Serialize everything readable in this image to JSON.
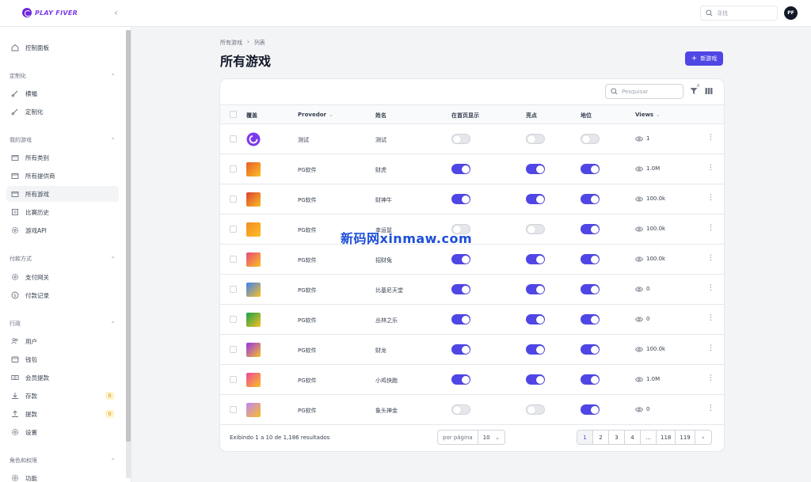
{
  "app": {
    "logo_text": "PLAY FIVER",
    "search_placeholder": "寻找",
    "avatar_initials": "PF"
  },
  "sidebar": {
    "dashboard": "控制面板",
    "groups": [
      {
        "title": "定制化",
        "items": [
          {
            "label": "横幅",
            "icon": "brush-icon"
          },
          {
            "label": "定制化",
            "icon": "brush-icon"
          }
        ]
      },
      {
        "title": "我的游戏",
        "items": [
          {
            "label": "所有类别",
            "icon": "folder-icon"
          },
          {
            "label": "所有提供商",
            "icon": "folder-icon"
          },
          {
            "label": "所有游戏",
            "icon": "folder-icon",
            "active": true
          },
          {
            "label": "比赛历史",
            "icon": "history-icon"
          },
          {
            "label": "游戏API",
            "icon": "gear-icon"
          }
        ]
      },
      {
        "title": "付款方式",
        "items": [
          {
            "label": "支付网关",
            "icon": "gear-icon"
          },
          {
            "label": "付款记录",
            "icon": "dollar-icon"
          }
        ]
      },
      {
        "title": "行政",
        "items": [
          {
            "label": "用户",
            "icon": "users-icon"
          },
          {
            "label": "钱包",
            "icon": "wallet-icon"
          },
          {
            "label": "会员提款",
            "icon": "cash-icon"
          },
          {
            "label": "存款",
            "icon": "download-icon",
            "badge": "0"
          },
          {
            "label": "提款",
            "icon": "upload-icon",
            "badge": "0"
          },
          {
            "label": "设置",
            "icon": "gear-icon"
          }
        ]
      },
      {
        "title": "角色和权限",
        "items": [
          {
            "label": "功能",
            "icon": "gear-icon"
          }
        ]
      }
    ]
  },
  "breadcrumb": {
    "root": "所有游戏",
    "sep": "›",
    "current": "列表"
  },
  "page_title": "所有游戏",
  "new_button": "新游戏",
  "table": {
    "search_placeholder": "Pesquisar",
    "filter_count": "0",
    "columns": {
      "cover": "覆盖",
      "provider": "Provedor",
      "name": "姓名",
      "home": "在首页显示",
      "highlight": "亮点",
      "featured": "地位",
      "views": "Views"
    },
    "rows": [
      {
        "provider": "测试",
        "name": "测试",
        "home": false,
        "highlight": false,
        "featured": false,
        "views": "1",
        "cover": "logo",
        "color": "#7c3aed"
      },
      {
        "provider": "PG软件",
        "name": "财虎",
        "home": true,
        "highlight": true,
        "featured": true,
        "views": "1.0M",
        "color": "#e85d2a"
      },
      {
        "provider": "PG软件",
        "name": "财神牛",
        "home": true,
        "highlight": true,
        "featured": true,
        "views": "100.0k",
        "color": "#d9412f"
      },
      {
        "provider": "PG软件",
        "name": "幸运鼠",
        "home": false,
        "highlight": false,
        "featured": true,
        "views": "100.0k",
        "color": "#f28c28"
      },
      {
        "provider": "PG软件",
        "name": "招财兔",
        "home": true,
        "highlight": true,
        "featured": true,
        "views": "100.0k",
        "color": "#e64a7a"
      },
      {
        "provider": "PG软件",
        "name": "比基尼天堂",
        "home": true,
        "highlight": true,
        "featured": true,
        "views": "0",
        "color": "#3b82f6"
      },
      {
        "provider": "PG软件",
        "name": "丛林之乐",
        "home": true,
        "highlight": true,
        "featured": true,
        "views": "0",
        "color": "#16a34a"
      },
      {
        "provider": "PG软件",
        "name": "财龙",
        "home": true,
        "highlight": true,
        "featured": true,
        "views": "100.0k",
        "color": "#9333ea"
      },
      {
        "provider": "PG软件",
        "name": "小鸡快跑",
        "home": true,
        "highlight": true,
        "featured": true,
        "views": "1.0M",
        "color": "#ec4899"
      },
      {
        "provider": "PG软件",
        "name": "象头神金",
        "home": false,
        "highlight": false,
        "featured": true,
        "views": "0",
        "color": "#c084fc"
      }
    ]
  },
  "footer": {
    "results": "Exibindo 1 a 10 de 1,186 resultados",
    "per_page_label": "por página",
    "per_page_value": "10",
    "pages": [
      "1",
      "2",
      "3",
      "4",
      "...",
      "118",
      "119",
      "›"
    ]
  },
  "watermark": "新码网xinmaw.com",
  "colors": {
    "accent": "#4f46e5",
    "toggle_off": "#e5e7eb"
  }
}
